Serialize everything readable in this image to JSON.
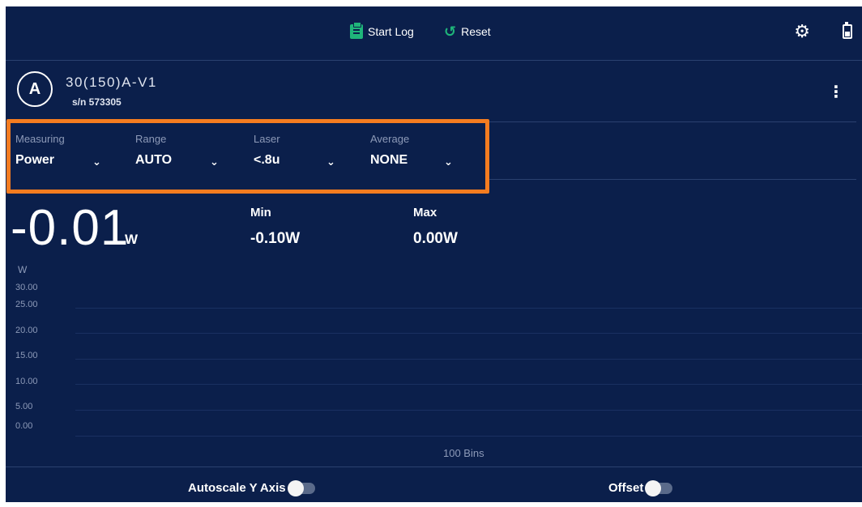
{
  "toolbar": {
    "start_log_label": "Start Log",
    "reset_label": "Reset"
  },
  "device": {
    "channel": "A",
    "model": "30(150)A-V1",
    "serial": "s/n 573305"
  },
  "selectors": [
    {
      "label": "Measuring",
      "value": "Power"
    },
    {
      "label": "Range",
      "value": "AUTO"
    },
    {
      "label": "Laser",
      "value": "<.8u"
    },
    {
      "label": "Average",
      "value": "NONE"
    }
  ],
  "readout": {
    "value": "-0.01",
    "unit": "W",
    "min_label": "Min",
    "min_value": "-0.10W",
    "max_label": "Max",
    "max_value": "0.00W"
  },
  "chart_data": {
    "type": "line",
    "ylabel": "W",
    "xlabel": "100 Bins",
    "yticks": [
      "30.00",
      "25.00",
      "20.00",
      "15.00",
      "10.00",
      "5.00",
      "0.00"
    ],
    "ylim": [
      0,
      30
    ],
    "series": []
  },
  "toggles": {
    "autoscale_label": "Autoscale Y Axis",
    "autoscale_on": false,
    "offset_label": "Offset",
    "offset_on": false
  },
  "colors": {
    "background": "#0b1f4b",
    "accent": "#1fb57a",
    "highlight_box": "#f47c20"
  }
}
